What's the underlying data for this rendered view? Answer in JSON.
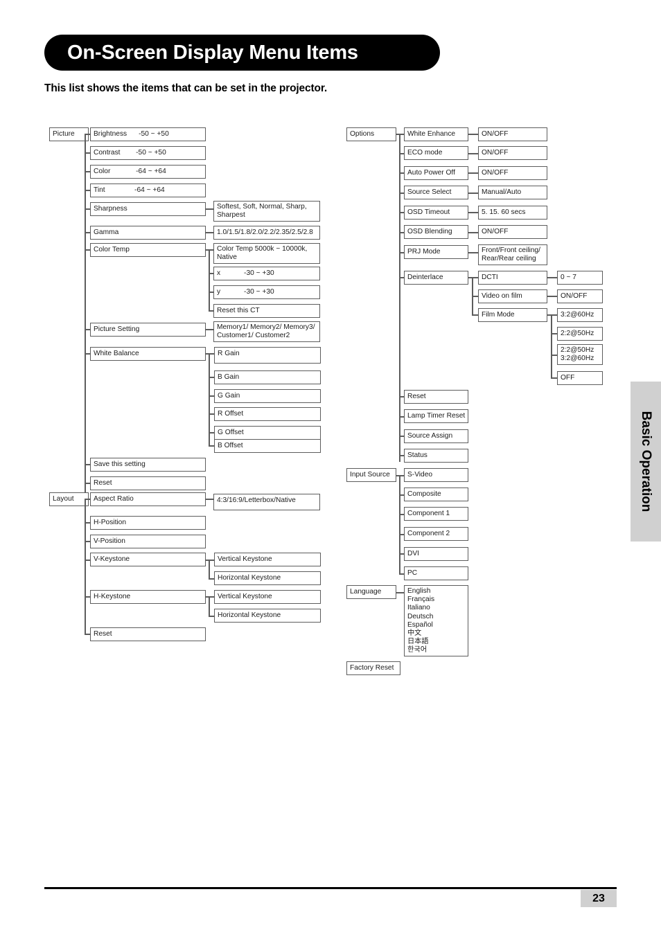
{
  "header": {
    "title": "On-Screen Display Menu Items",
    "subtitle": "This list shows the items that can be set in the projector."
  },
  "side_tab": {
    "label": "Basic Operation"
  },
  "footer": {
    "page_number": "23"
  },
  "menu": {
    "picture": {
      "label": "Picture",
      "items": {
        "brightness": "Brightness      -50 ~ +50",
        "contrast": "Contrast        -50 ~ +50",
        "color": "Color             -64 ~ +64",
        "tint": "Tint               -64 ~ +64",
        "sharpness": "Sharpness",
        "sharpness_values": "Softest, Soft, Normal, Sharp,\nSharpest",
        "gamma": "Gamma",
        "gamma_values": "1.0/1.5/1.8/2.0/2.2/2.35/2.5/2.8",
        "color_temp": "Color Temp",
        "color_temp_values": "Color Temp 5000k ~ 10000k,\nNative",
        "color_temp_x": "x            -30 ~ +30",
        "color_temp_y": "y            -30 ~ +30",
        "color_temp_reset": "Reset this CT",
        "picture_setting": "Picture Setting",
        "picture_setting_values": "Memory1/ Memory2/ Memory3/\nCustomer1/ Customer2",
        "white_balance": "White Balance",
        "wb_r_gain": "R Gain",
        "wb_b_gain": "B Gain",
        "wb_g_gain": "G Gain",
        "wb_r_offset": "R Offset",
        "wb_g_offset": "G Offset",
        "wb_b_offset": "B Offset",
        "save_this_setting": "Save this setting",
        "reset": "Reset"
      }
    },
    "layout": {
      "label": "Layout",
      "items": {
        "aspect_ratio": "Aspect Ratio",
        "aspect_ratio_values": "4:3/16:9/Letterbox/Native",
        "h_position": "H-Position",
        "v_position": "V-Position",
        "v_keystone": "V-Keystone",
        "v_keystone_vertical": "Vertical Keystone",
        "v_keystone_horizontal": "Horizontal Keystone",
        "h_keystone": "H-Keystone",
        "h_keystone_vertical": "Vertical Keystone",
        "h_keystone_horizontal": "Horizontal Keystone",
        "reset": "Reset"
      }
    },
    "options": {
      "label": "Options",
      "items": {
        "white_enhance": "White Enhance",
        "white_enhance_values": "ON/OFF",
        "eco_mode": "ECO mode",
        "eco_mode_values": "ON/OFF",
        "auto_power_off": "Auto Power Off",
        "auto_power_off_values": "ON/OFF",
        "source_select": "Source Select",
        "source_select_values": "Manual/Auto",
        "osd_timeout": "OSD Timeout",
        "osd_timeout_values": "5. 15. 60 secs",
        "osd_blending": "OSD Blending",
        "osd_blending_values": "ON/OFF",
        "prj_mode": "PRJ Mode",
        "prj_mode_values": "Front/Front ceiling/\nRear/Rear ceiling",
        "deinterlace": "Deinterlace",
        "dcti": "DCTI",
        "dcti_values": "0 ~ 7",
        "video_on_film": "Video on film",
        "video_on_film_values": "ON/OFF",
        "film_mode": "Film Mode",
        "film_mode_v1": "3:2@60Hz",
        "film_mode_v2": "2:2@50Hz",
        "film_mode_v3": "2:2@50Hz\n3:2@60Hz",
        "film_mode_v4": "OFF",
        "reset": "Reset",
        "lamp_timer_reset": "Lamp Timer Reset",
        "source_assign": "Source Assign",
        "status": "Status"
      }
    },
    "input_source": {
      "label": "Input Source",
      "items": {
        "s_video": "S-Video",
        "composite": "Composite",
        "component_1": "Component 1",
        "component_2": "Component 2",
        "dvi": "DVI",
        "pc": "PC"
      }
    },
    "language": {
      "label": "Language",
      "values": "English\nFrançais\nItaliano\nDeutsch\nEspañol\n中文\n日本語\n한국어"
    },
    "factory_reset": {
      "label": "Factory Reset"
    }
  }
}
